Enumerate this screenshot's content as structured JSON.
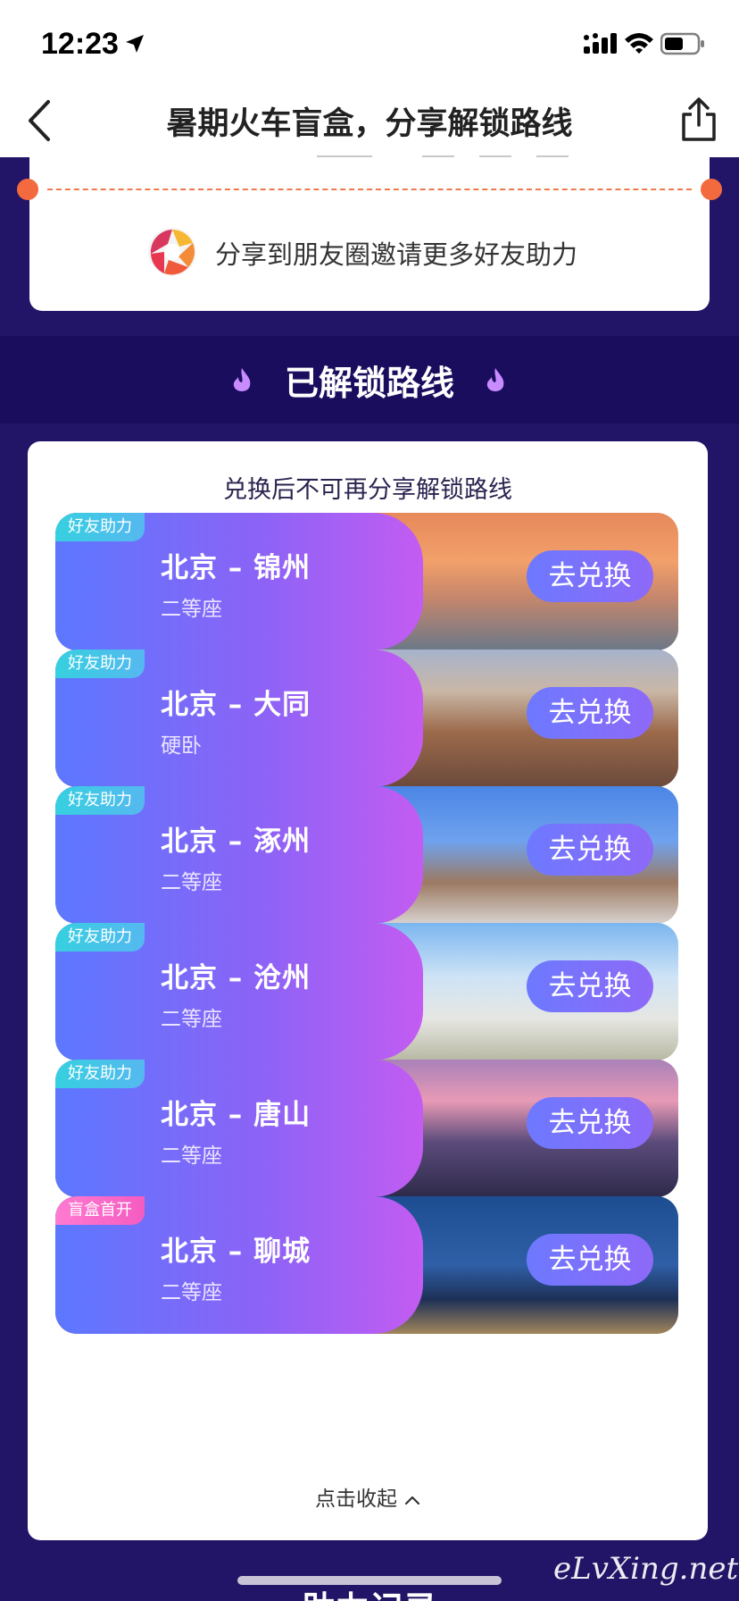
{
  "status_bar": {
    "time": "12:23"
  },
  "nav": {
    "title": "暑期火车盲盒，分享解锁路线"
  },
  "share_card": {
    "text": "分享到朋友圈邀请更多好友助力"
  },
  "section": {
    "title": "已解锁路线"
  },
  "routes_card": {
    "note": "兑换后不可再分享解锁路线",
    "button_label": "去兑换",
    "collapse_label": "点击收起",
    "routes": [
      {
        "tag": "好友助力",
        "tag_type": "friend",
        "name": "北京 – 锦州",
        "seat": "二等座",
        "scene": "sunset"
      },
      {
        "tag": "好友助力",
        "tag_type": "friend",
        "name": "北京 – 大同",
        "seat": "硬卧",
        "scene": "oldtown"
      },
      {
        "tag": "好友助力",
        "tag_type": "friend",
        "name": "北京 – 涿州",
        "seat": "二等座",
        "scene": "tower"
      },
      {
        "tag": "好友助力",
        "tag_type": "friend",
        "name": "北京 – 沧州",
        "seat": "二等座",
        "scene": "marble"
      },
      {
        "tag": "好友助力",
        "tag_type": "friend",
        "name": "北京 – 唐山",
        "seat": "二等座",
        "scene": "nightcity"
      },
      {
        "tag": "盲盒首开",
        "tag_type": "box",
        "name": "北京 – 聊城",
        "seat": "二等座",
        "scene": "nightlake"
      }
    ]
  },
  "bottom": {
    "next_section_title": "助力记录"
  },
  "watermark": "eLvXing.net",
  "colors": {
    "page_bg": "#221466",
    "band_bg": "#1a0d5e",
    "accent_orange": "#f26a3e",
    "button_purple": "#7a70ff"
  }
}
